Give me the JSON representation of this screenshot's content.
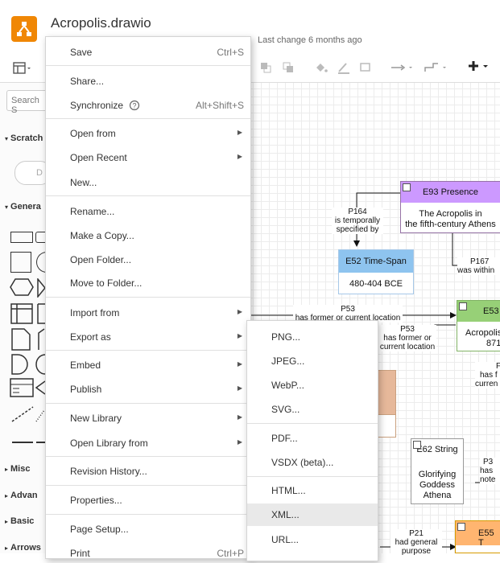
{
  "app": {
    "title": "Acropolis.drawio",
    "last_change": "Last change 6 months ago",
    "logo_icon": "drawio-logo",
    "accent": "#f08705"
  },
  "sidebar": {
    "search_placeholder": "Search S",
    "scratchpad": "Scratch",
    "drag_hint": "D",
    "general": "Genera",
    "misc": "Misc",
    "advanced": "Advan",
    "basic": "Basic",
    "arrows": "Arrows"
  },
  "menu": {
    "save": "Save",
    "save_sc": "Ctrl+S",
    "share": "Share...",
    "synchronize": "Synchronize",
    "synchronize_sc": "Alt+Shift+S",
    "open_from": "Open from",
    "open_recent": "Open Recent",
    "new": "New...",
    "rename": "Rename...",
    "make_copy": "Make a Copy...",
    "open_folder": "Open Folder...",
    "move_to_folder": "Move to Folder...",
    "import_from": "Import from",
    "export_as": "Export as",
    "embed": "Embed",
    "publish": "Publish",
    "new_library": "New Library",
    "open_library_from": "Open Library from",
    "revision_history": "Revision History...",
    "properties": "Properties...",
    "page_setup": "Page Setup...",
    "print": "Print",
    "print_sc": "Ctrl+P"
  },
  "export_menu": {
    "png": "PNG...",
    "jpeg": "JPEG...",
    "webp": "WebP...",
    "svg": "SVG...",
    "pdf": "PDF...",
    "vsdx": "VSDX (beta)...",
    "html": "HTML...",
    "xml": "XML...",
    "url": "URL..."
  },
  "diagram": {
    "e93_title": "E93 Presence",
    "e93_body_1": "The Acropolis in",
    "e93_body_2": "the fifth-century Athens",
    "e52_title": "E52 Time-Span",
    "e52_body": "480-404 BCE",
    "e53_title": "E53",
    "e53_body_1": "Acropolis",
    "e53_body_2": "871",
    "e62_title": "E62 String",
    "e62_body_1": "Glorifying",
    "e62_body_2": "Goddess",
    "e62_body_3": "Athena",
    "e55_title": "E55 T",
    "p164_a": "P164",
    "p164_b": "is temporally",
    "p164_c": "specified by",
    "p167_a": "P167",
    "p167_b": "was within",
    "p53a_a": "P53",
    "p53a_b": "has former or current location",
    "p53b_a": "P53",
    "p53b_b": "has former or",
    "p53b_c": "current location",
    "p_right_a": "F",
    "p_right_b": "has f",
    "p_right_c": "curren",
    "p3_a": "P3",
    "p3_b": "has",
    "p3_c": "note",
    "p21_a": "P21",
    "p21_b": "had general",
    "p21_c": "purpose"
  }
}
